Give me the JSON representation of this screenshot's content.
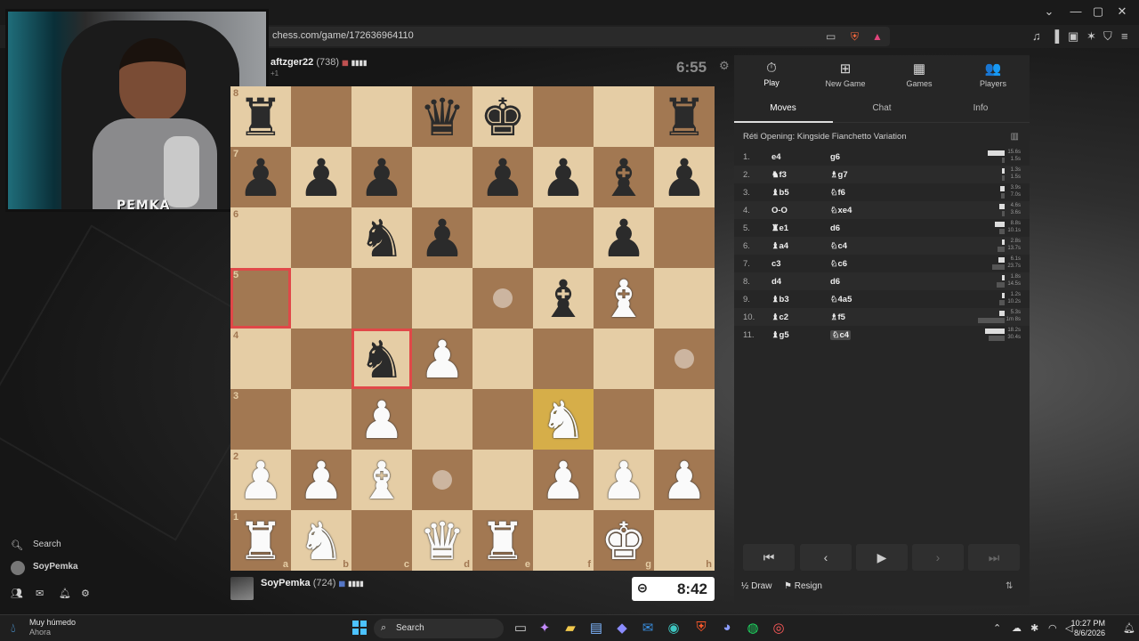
{
  "window": {
    "minimize": "—",
    "maximize": "▢",
    "close": "✕",
    "chevron": "⌄"
  },
  "browser": {
    "url": "chess.com/game/172636964110"
  },
  "webcam": {
    "overlay_text": "PEMKA"
  },
  "sidebar": {
    "search_label": "Search",
    "user_name": "SoyPemka"
  },
  "top_player": {
    "name": "aftzger22",
    "rating": "(738)",
    "sub": "+1",
    "clock": "6:55"
  },
  "bottom_player": {
    "name": "SoyPemka",
    "rating": "(724)",
    "clock": "8:42"
  },
  "board": {
    "ranks": [
      "8",
      "7",
      "6",
      "5",
      "4",
      "3",
      "2",
      "1"
    ],
    "files": [
      "a",
      "b",
      "c",
      "d",
      "e",
      "f",
      "g",
      "h"
    ],
    "pieces": {
      "a8": "br",
      "d8": "bq",
      "e8": "bk",
      "h8": "br",
      "a7": "bp",
      "b7": "bp",
      "c7": "bp",
      "e7": "bp",
      "f7": "bp",
      "g7": "bb",
      "h7": "bp",
      "c6": "bn",
      "d6": "bp",
      "g6": "bp",
      "f5": "bb",
      "g5": "wb",
      "c4": "bn",
      "d4": "wp",
      "c3": "wp",
      "f3": "wn",
      "a2": "wp",
      "b2": "wp",
      "c2": "wb",
      "f2": "wp",
      "g2": "wp",
      "h2": "wp",
      "a1": "wr",
      "b1": "wn",
      "d1": "wq",
      "e1": "wr",
      "g1": "wk"
    },
    "highlight_last_move": [
      "f3"
    ],
    "highlight_red": [
      "a5",
      "c4"
    ],
    "move_dots": [
      "e5",
      "h4",
      "d2"
    ]
  },
  "panel": {
    "nav": [
      {
        "label": "Play",
        "icon": "⏱",
        "active": true
      },
      {
        "label": "New Game",
        "icon": "⊞",
        "active": false
      },
      {
        "label": "Games",
        "icon": "▦",
        "active": false
      },
      {
        "label": "Players",
        "icon": "👥",
        "active": false
      }
    ],
    "tabs": [
      "Moves",
      "Chat",
      "Info"
    ],
    "opening": "Réti Opening: Kingside Fianchetto Variation",
    "moves": [
      {
        "n": "1.",
        "w": "e4",
        "b": "g6",
        "tw": "15.6s",
        "tb": "1.5s"
      },
      {
        "n": "2.",
        "w": "♞f3",
        "b": "♗g7",
        "tw": "1.3s",
        "tb": "1.5s"
      },
      {
        "n": "3.",
        "w": "♝b5",
        "b": "♘f6",
        "tw": "3.9s",
        "tb": "7.0s"
      },
      {
        "n": "4.",
        "w": "O-O",
        "b": "♘xe4",
        "tw": "4.6s",
        "tb": "3.6s"
      },
      {
        "n": "5.",
        "w": "♜e1",
        "b": "d6",
        "tw": "8.8s",
        "tb": "10.1s"
      },
      {
        "n": "6.",
        "w": "♝a4",
        "b": "♘c4",
        "tw": "2.8s",
        "tb": "13.7s"
      },
      {
        "n": "7.",
        "w": "c3",
        "b": "♘c6",
        "tw": "6.1s",
        "tb": "23.7s"
      },
      {
        "n": "8.",
        "w": "d4",
        "b": "d6",
        "tw": "1.8s",
        "tb": "14.5s"
      },
      {
        "n": "9.",
        "w": "♝b3",
        "b": "♘4a5",
        "tw": "1.2s",
        "tb": "10.2s"
      },
      {
        "n": "10.",
        "w": "♝c2",
        "b": "♗f5",
        "tw": "5.3s",
        "tb": "1m 8s"
      },
      {
        "n": "11.",
        "w": "♝g5",
        "b": "♘c4",
        "tw": "18.2s",
        "tb": "30.4s"
      }
    ],
    "draw_label": "Draw",
    "resign_label": "Resign",
    "draw_icon": "½",
    "resign_icon": "⚑"
  },
  "taskbar": {
    "weather_main": "Muy húmedo",
    "weather_sub": "Ahora",
    "search_label": "Search",
    "time": "10:27 PM",
    "date": "8/6/2026"
  }
}
